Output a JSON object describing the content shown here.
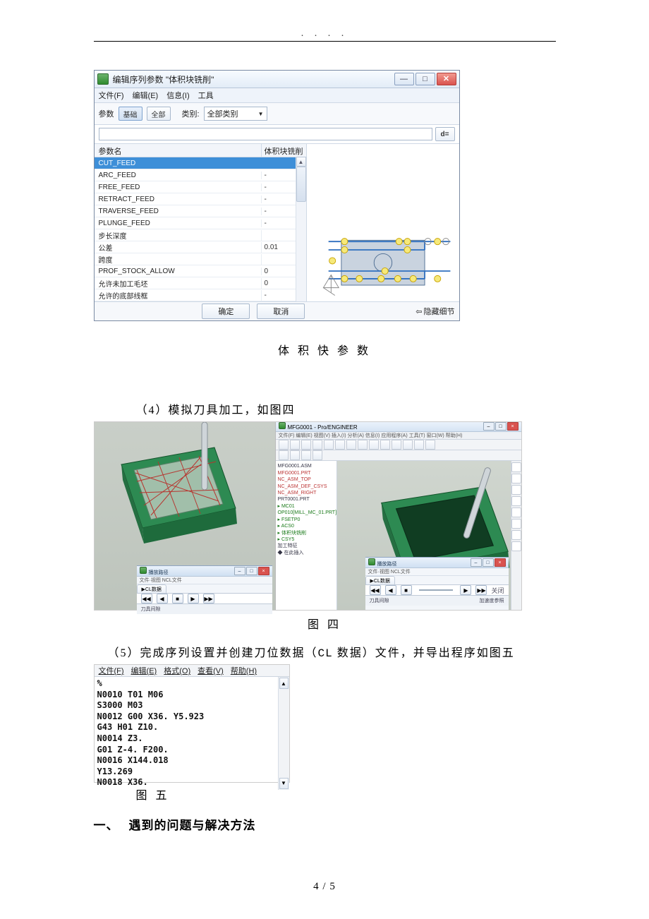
{
  "header_dots": ".  .  .  .",
  "dialog": {
    "title": "编辑序列参数 \"体积块铣削\"",
    "win": {
      "min": "—",
      "max": "□",
      "close": "✕"
    },
    "menus": [
      "文件(F)",
      "编辑(E)",
      "信息(I)",
      "工具"
    ],
    "toolbar": {
      "group_label": "参数",
      "btn1": "基础",
      "btn2": "全部",
      "cat_label": "类别:",
      "cat_value": "全部类别"
    },
    "d_btn": "d=",
    "headers": {
      "name": "参数名",
      "val": "体积块铣削"
    },
    "rows": [
      {
        "name": "CUT_FEED",
        "val": ""
      },
      {
        "name": "ARC_FEED",
        "val": "-"
      },
      {
        "name": "FREE_FEED",
        "val": "-"
      },
      {
        "name": "RETRACT_FEED",
        "val": "-"
      },
      {
        "name": "TRAVERSE_FEED",
        "val": "-"
      },
      {
        "name": "PLUNGE_FEED",
        "val": "-"
      },
      {
        "name": "步长深度",
        "val": ""
      },
      {
        "name": "公差",
        "val": "0.01"
      },
      {
        "name": "跨度",
        "val": ""
      },
      {
        "name": "PROF_STOCK_ALLOW",
        "val": "0"
      },
      {
        "name": "允许未加工毛坯",
        "val": "0"
      },
      {
        "name": "允许的底部线框",
        "val": "-"
      }
    ],
    "ok": "确定",
    "cancel": "取消",
    "hide": "隐藏细节"
  },
  "caption1": "体 积 快 参 数",
  "para4": "（4）模拟刀具加工，如图四",
  "fig4": {
    "right_title": "MFG0001 - Pro/ENGINEER",
    "right_menu": "文件(F) 编辑(E) 视图(V) 插入(I) 分析(A) 信息(I) 应用程序(A) 工具(T) 窗口(W) 帮助(H)",
    "tree": [
      {
        "t": "MFG0001.ASM",
        "c": ""
      },
      {
        "t": "MFG0001.PRT",
        "c": "r"
      },
      {
        "t": "NC_ASM_TOP",
        "c": "r"
      },
      {
        "t": "NC_ASM_DEF_CSYS",
        "c": "r"
      },
      {
        "t": "NC_ASM_RIGHT",
        "c": "r"
      },
      {
        "t": "PRT0001.PRT",
        "c": ""
      },
      {
        "t": "▸ MC01",
        "c": "g"
      },
      {
        "t": "OP010[MILL_MC_01.PRT]",
        "c": "g"
      },
      {
        "t": "▸ FSETP0",
        "c": "g"
      },
      {
        "t": "▸ ACS0",
        "c": "g"
      },
      {
        "t": "▸ 体积块铣削",
        "c": "g"
      },
      {
        "t": "▸ CSY5",
        "c": "g"
      },
      {
        "t": "加工特征",
        "c": ""
      },
      {
        "t": "◆ 在此插入",
        "c": ""
      }
    ],
    "play": {
      "title": "播放路径",
      "sub": "文件·视图  NCL文件",
      "tab": "CL数据",
      "close_lbl": "关闭",
      "status_left": "刀具间隙",
      "status_right": "加速度参照"
    }
  },
  "caption4": "图 四",
  "para5_a": "（5）完成序列设置并创建刀位数据（",
  "para5_b": "CL",
  "para5_c": " 数据）文件，并导出程序如图五",
  "fig5": {
    "menus": [
      "文件(F)",
      "编辑(E)",
      "格式(O)",
      "查看(V)",
      "帮助(H)"
    ],
    "code": "%\nN0010 T01 M06\nS3000 M03\nN0012 G00 X36. Y5.923\nG43 H01 Z10.\nN0014 Z3.\nG01 Z-4. F200.\nN0016 X144.018\nY13.269\nN0018 X36."
  },
  "caption5": "图 五",
  "heading": {
    "num": "一、",
    "text": "遇到的问题与解决方法"
  },
  "footer": "4 / 5"
}
